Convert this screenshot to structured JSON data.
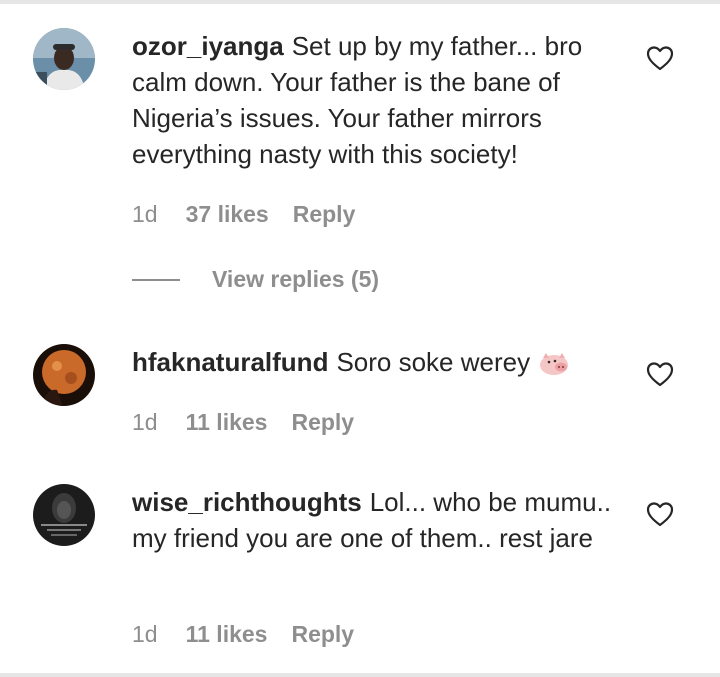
{
  "comments": [
    {
      "username": "ozor_iyanga",
      "text": "Set up by my father... bro calm down. Your father is the bane of Nigeria’s issues. Your father mirrors everything nasty with this society!",
      "time": "1d",
      "likes": "37 likes",
      "reply": "Reply",
      "view_replies": "View replies (5)"
    },
    {
      "username": "hfaknaturalfund",
      "text": "Soro soke werey",
      "emoji": "pig-face-emoji",
      "time": "1d",
      "likes": "11 likes",
      "reply": "Reply"
    },
    {
      "username": "wise_richthoughts",
      "text": "Lol... who be mumu.. my friend you are one of them.. rest jare",
      "time": "1d",
      "likes": "11 likes",
      "reply": "Reply"
    }
  ],
  "colors": {
    "text": "#262626",
    "secondary": "#8e8e8e"
  }
}
